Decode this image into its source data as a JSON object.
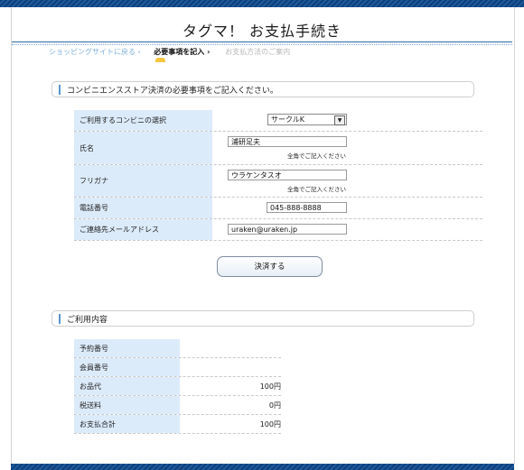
{
  "page": {
    "title": "タグマ！ お支払手続き"
  },
  "breadcrumb": {
    "back": "ショッピングサイトに戻る ‹",
    "current": "必要事項を記入 ›",
    "next": "お支払方法のご案内"
  },
  "form_section": {
    "heading": "コンビニエンスストア決済の必要事項をご記入ください。",
    "store": {
      "label": "ご利用するコンビニの選択",
      "selected": "サークルK"
    },
    "name": {
      "label": "氏名",
      "value": "浦研足夫",
      "note": "全角でご記入ください"
    },
    "kana": {
      "label": "フリガナ",
      "value": "ウラケンタスオ",
      "note": "全角でご記入ください"
    },
    "phone": {
      "label": "電話番号",
      "value": "045-888-8888"
    },
    "email": {
      "label": "ご連絡先メールアドレス",
      "value": "uraken@uraken.jp"
    },
    "submit_label": "決済する"
  },
  "usage_section": {
    "heading": "ご利用内容",
    "rows": [
      {
        "label": "予約番号",
        "value": ""
      },
      {
        "label": "会員番号",
        "value": ""
      },
      {
        "label": "お品代",
        "value": "100円"
      },
      {
        "label": "税送料",
        "value": "0円"
      },
      {
        "label": "お支払合計",
        "value": "100円"
      }
    ]
  },
  "colors": {
    "accent": "#1d5a9e",
    "label_bg": "#dcebfa",
    "section_bar": "#5b95cf"
  }
}
